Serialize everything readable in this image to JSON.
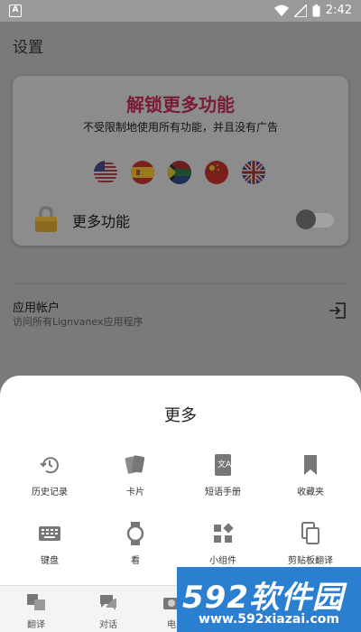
{
  "status_bar": {
    "app_badge": "A",
    "time": "2:42"
  },
  "page": {
    "title": "设置"
  },
  "promo": {
    "title": "解锁更多功能",
    "subtitle": "不受限制地使用所有功能，并且没有广告",
    "flags": [
      "us-flag",
      "es-flag",
      "za-flag",
      "cn-flag",
      "uk-flag"
    ],
    "feature_label": "更多功能",
    "toggle_on": false
  },
  "account": {
    "title": "应用帐户",
    "subtitle": "访问所有Lignvanex应用程序"
  },
  "sheet": {
    "title": "更多",
    "items": [
      {
        "label": "历史记录",
        "icon": "history-icon"
      },
      {
        "label": "卡片",
        "icon": "cards-icon"
      },
      {
        "label": "短语手册",
        "icon": "phrasebook-icon"
      },
      {
        "label": "收藏夹",
        "icon": "bookmark-icon"
      },
      {
        "label": "键盘",
        "icon": "keyboard-icon"
      },
      {
        "label": "看",
        "icon": "watch-icon"
      },
      {
        "label": "小组件",
        "icon": "widgets-icon"
      },
      {
        "label": "剪贴板翻译",
        "icon": "clipboard-icon"
      }
    ]
  },
  "bottom_nav": {
    "items": [
      {
        "label": "翻译"
      },
      {
        "label": "对话"
      },
      {
        "label": "电"
      }
    ]
  },
  "watermark": {
    "main": "592软件园",
    "url": "www.592xiazai.com"
  },
  "colors": {
    "promo_title": "#7a1c35",
    "watermark_bg": "#2a7fd0",
    "scrim": "#7a7a7a"
  }
}
